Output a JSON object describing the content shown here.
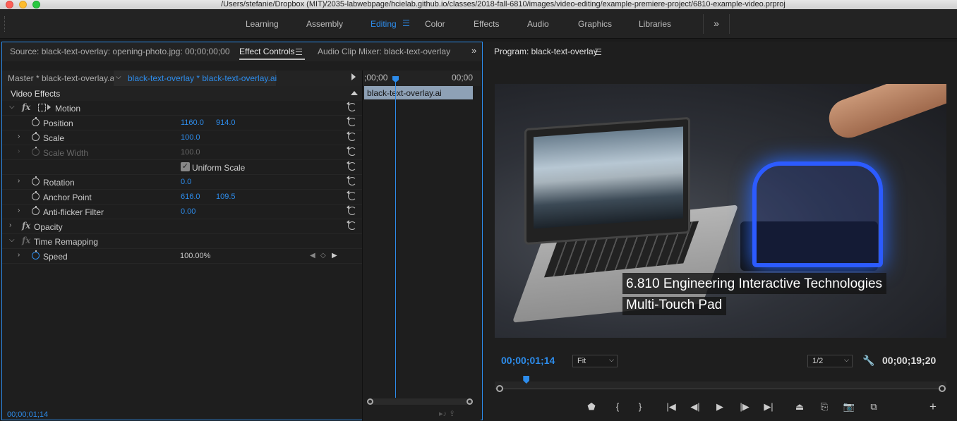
{
  "window": {
    "title": "/Users/stefanie/Dropbox (MIT)/2035-labwebpage/hcielab.github.io/classes/2018-fall-6810/images/video-editing/example-premiere-project/6810-example-video.prproj"
  },
  "workspaces": {
    "tabs": [
      "Learning",
      "Assembly",
      "Editing",
      "Color",
      "Effects",
      "Audio",
      "Graphics",
      "Libraries"
    ],
    "active": "Editing",
    "more_glyph": "»"
  },
  "left_panel": {
    "tabs": {
      "source": "Source: black-text-overlay: opening-photo.jpg: 00;00;00;00",
      "effect_controls": "Effect Controls",
      "audio_clip_mixer": "Audio Clip Mixer: black-text-overlay"
    },
    "more_glyph": "»",
    "master_label": "Master * black-text-overlay.ai",
    "clip_label": "black-text-overlay * black-text-overlay.ai",
    "section_title": "Video Effects",
    "motion": {
      "label": "Motion",
      "position": {
        "label": "Position",
        "x": "1160.0",
        "y": "914.0"
      },
      "scale": {
        "label": "Scale",
        "value": "100.0"
      },
      "scale_width": {
        "label": "Scale Width",
        "value": "100.0"
      },
      "uniform_scale": {
        "label": "Uniform Scale",
        "checked": true
      },
      "rotation": {
        "label": "Rotation",
        "value": "0.0"
      },
      "anchor_point": {
        "label": "Anchor Point",
        "x": "616.0",
        "y": "109.5"
      },
      "anti_flicker": {
        "label": "Anti-flicker Filter",
        "value": "0.00"
      }
    },
    "opacity": {
      "label": "Opacity"
    },
    "time_remapping": {
      "label": "Time Remapping",
      "speed": {
        "label": "Speed",
        "value": "100.00%"
      }
    },
    "mini_timeline": {
      "start": ";00;00",
      "end": "00;00",
      "clip_label": "black-text-overlay.ai"
    },
    "timecode": "00;00;01;14"
  },
  "program_monitor": {
    "title": "Program: black-text-overlay",
    "caption": {
      "line1": "6.810 Engineering Interactive Technologies",
      "line2": "Multi-Touch Pad"
    },
    "current_timecode": "00;00;01;14",
    "zoom": "Fit",
    "resolution": "1/2",
    "duration": "00;00;19;20",
    "playhead_fraction": 0.07
  },
  "colors": {
    "accent": "#2d8ceb",
    "panel_bg": "#1e1e1e",
    "clip_bar": "#8ea1b6"
  }
}
